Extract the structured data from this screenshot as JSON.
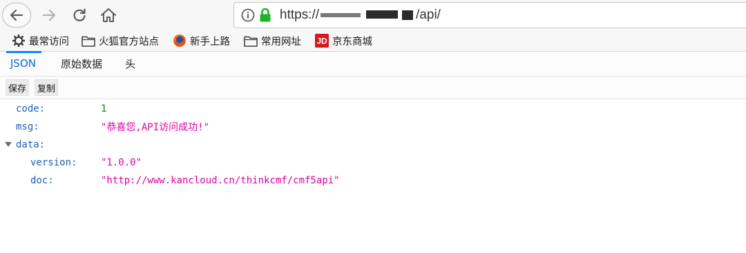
{
  "navigation": {
    "back_icon": "arrow-left-icon",
    "forward_icon": "arrow-right-icon",
    "reload_icon": "reload-icon",
    "home_icon": "home-icon"
  },
  "urlbar": {
    "info_icon": "info-icon",
    "lock_icon": "lock-icon",
    "url_prefix": "https://",
    "url_suffix": "/api/",
    "lock_color": "#1fb524"
  },
  "bookmarks": [
    {
      "label": "最常访问",
      "icon": "gear-icon"
    },
    {
      "label": "火狐官方站点",
      "icon": "folder-icon"
    },
    {
      "label": "新手上路",
      "icon": "firefox-icon"
    },
    {
      "label": "常用网址",
      "icon": "folder-icon"
    },
    {
      "label": "京东商城",
      "icon": "jd-icon"
    }
  ],
  "viewer": {
    "tabs": [
      {
        "label": "JSON",
        "active": true
      },
      {
        "label": "原始数据",
        "active": false
      },
      {
        "label": "头",
        "active": false
      }
    ],
    "toolbar": {
      "save_label": "保存",
      "copy_label": "复制"
    }
  },
  "json": {
    "rows": [
      {
        "key": "code:",
        "value": "1",
        "type": "number"
      },
      {
        "key": "msg:",
        "value": "\"恭喜您,API访问成功!\"",
        "type": "string"
      },
      {
        "key": "data:",
        "value": "",
        "type": "object",
        "expanded": true
      },
      {
        "key": "version:",
        "value": "\"1.0.0\"",
        "type": "string"
      },
      {
        "key": "doc:",
        "value": "\"http://www.kancloud.cn/thinkcmf/cmf5api\"",
        "type": "string"
      }
    ]
  },
  "colors": {
    "json_key": "#1a5fb4",
    "json_number": "#058b00",
    "json_string": "#dd00a9",
    "active_tab": "#0a84ff"
  }
}
